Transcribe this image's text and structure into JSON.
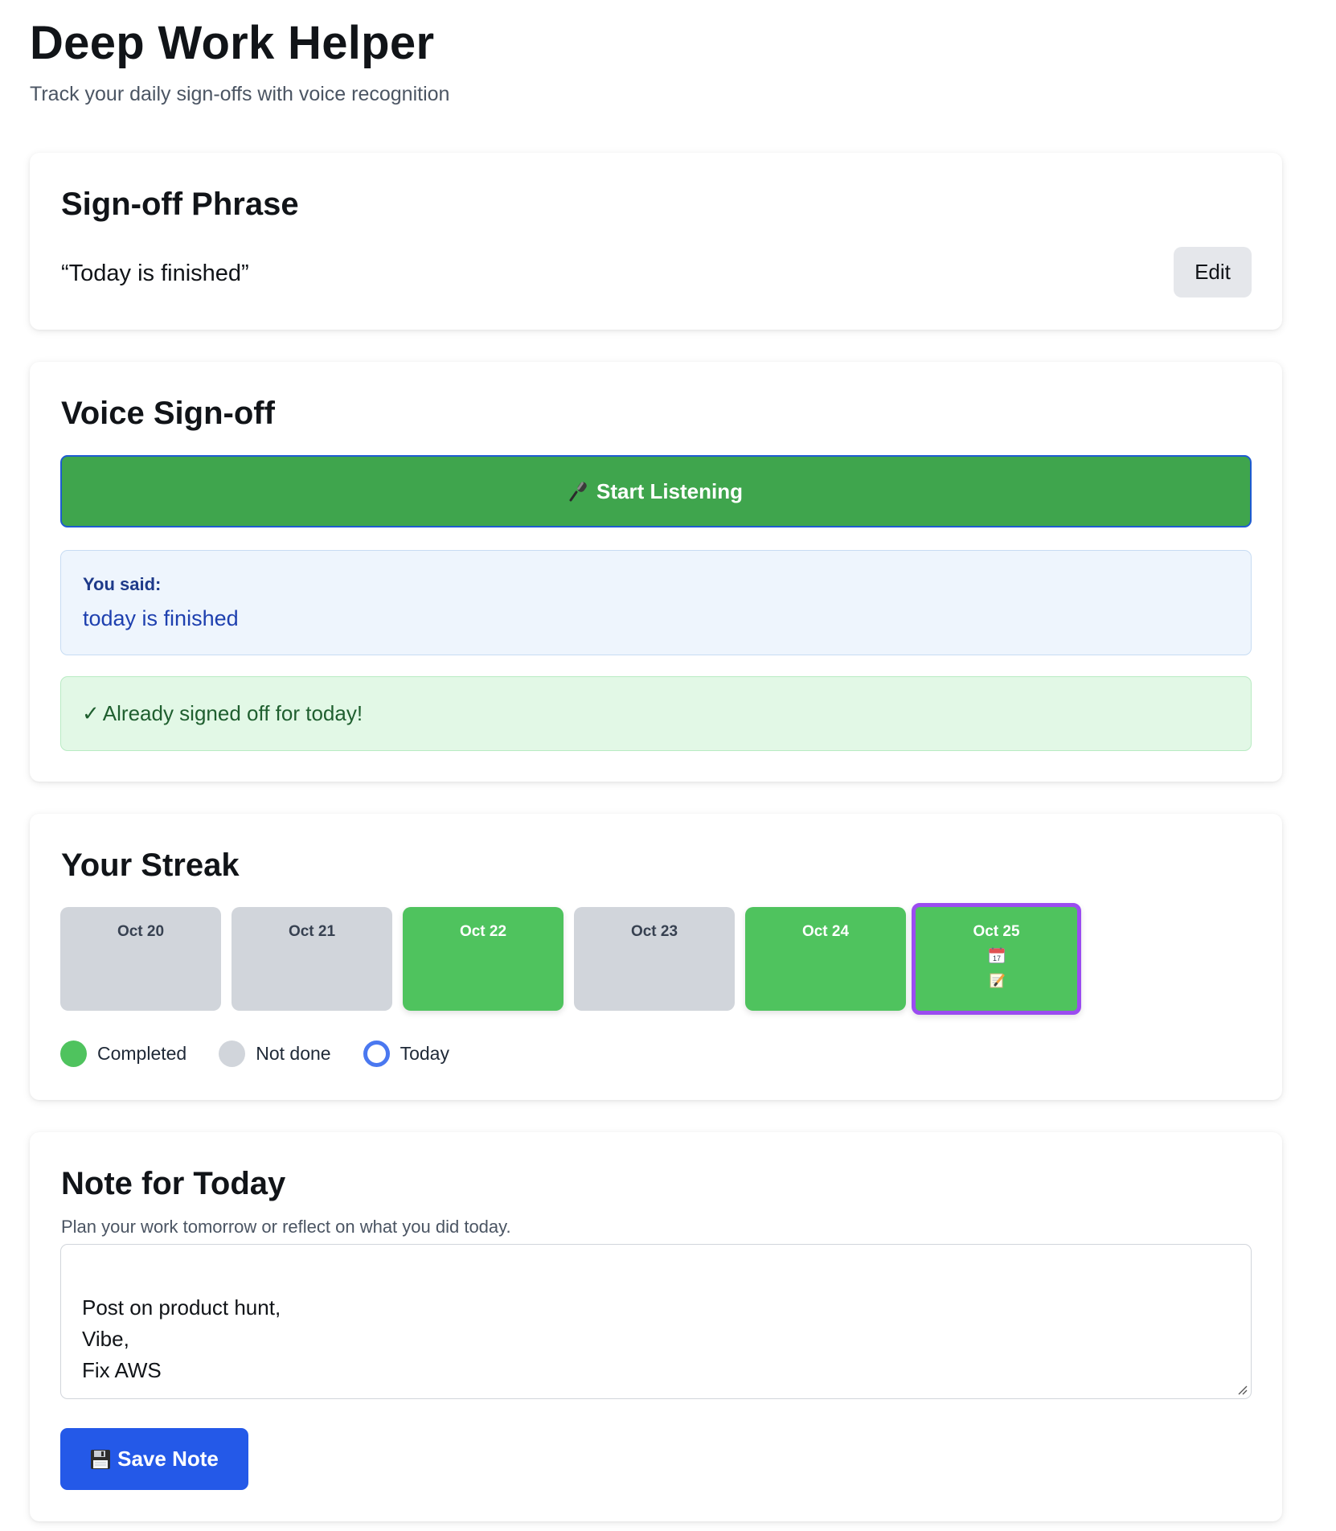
{
  "header": {
    "title": "Deep Work Helper",
    "subtitle": "Track your daily sign-offs with voice recognition"
  },
  "phrase_card": {
    "title": "Sign-off Phrase",
    "phrase": "“Today is finished”",
    "edit_label": "Edit"
  },
  "voice_card": {
    "title": "Voice Sign-off",
    "listen_label": "Start Listening",
    "said_label": "You said:",
    "said_text": "today is finished",
    "status_text": "Already signed off for today!"
  },
  "streak_card": {
    "title": "Your Streak",
    "days": [
      {
        "label": "Oct 20",
        "status": "not-done"
      },
      {
        "label": "Oct 21",
        "status": "not-done"
      },
      {
        "label": "Oct 22",
        "status": "completed"
      },
      {
        "label": "Oct 23",
        "status": "not-done"
      },
      {
        "label": "Oct 24",
        "status": "completed"
      },
      {
        "label": "Oct 25",
        "status": "completed",
        "today": true,
        "icons": [
          "calendar-icon",
          "memo-icon"
        ]
      }
    ],
    "legend": {
      "completed": "Completed",
      "not_done": "Not done",
      "today": "Today"
    },
    "colors": {
      "completed": "#4fc35e",
      "not_done": "#d1d5db",
      "today_ring": "#4a78f0",
      "today_tile_border": "#9b4cf0"
    }
  },
  "note_card": {
    "title": "Note for Today",
    "hint": "Plan your work tomorrow or reflect on what you did today.",
    "note_text": "Post on product hunt,\nVibe,\nFix AWS",
    "save_label": "Save Note"
  }
}
